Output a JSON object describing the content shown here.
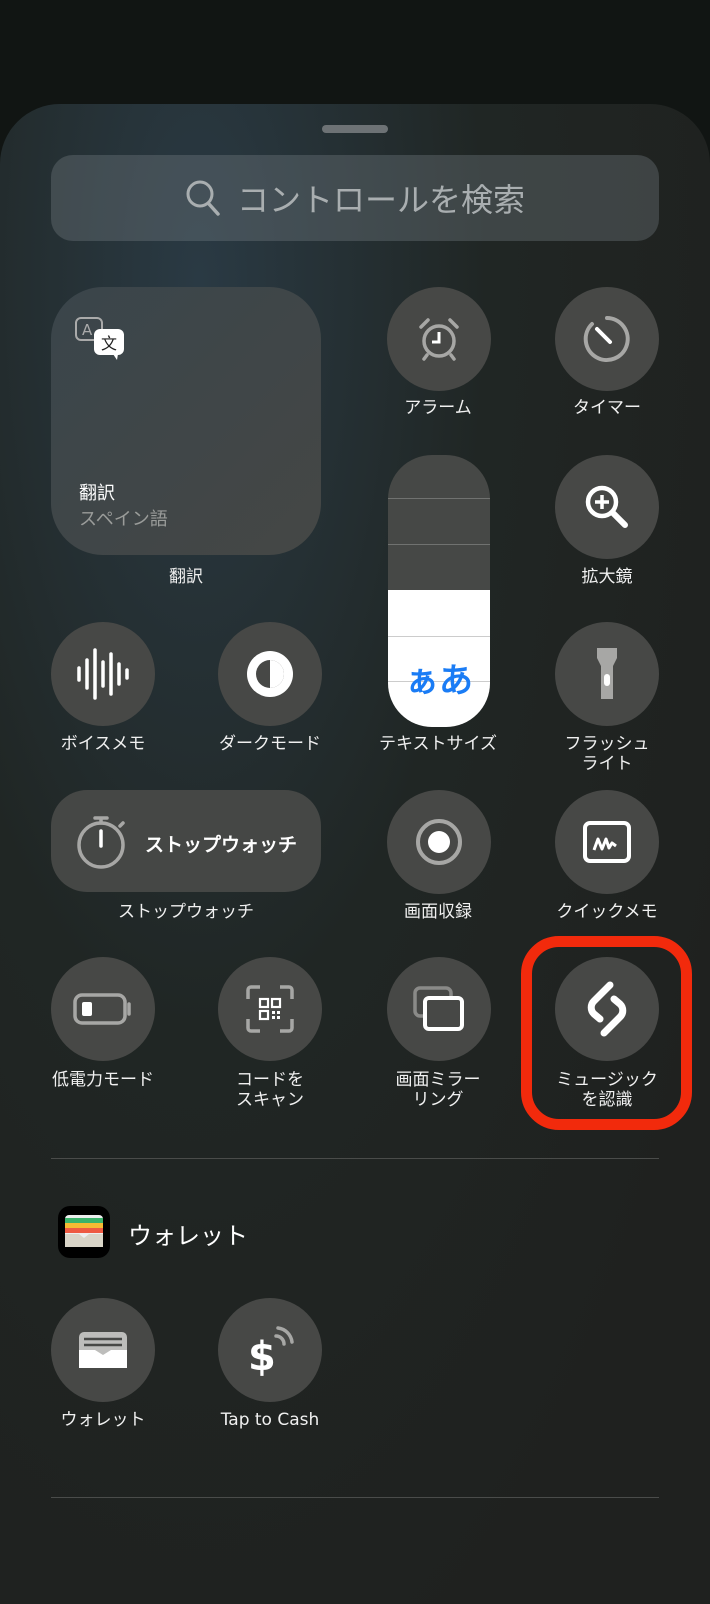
{
  "search": {
    "placeholder": "コントロールを検索"
  },
  "translate": {
    "title": "翻訳",
    "subtitle": "スペイン語",
    "label": "翻訳"
  },
  "controls": {
    "alarm": "アラーム",
    "timer": "タイマー",
    "magnifier": "拡大鏡",
    "text_size": "テキストサイズ",
    "text_size_glyph": "ぁあ",
    "text_size_level": 0.5,
    "voice_memo": "ボイスメモ",
    "dark_mode": "ダークモード",
    "flashlight_1": "フラッシュ",
    "flashlight_2": "ライト",
    "stopwatch_tile": "ストップウォッチ",
    "stopwatch": "ストップウォッチ",
    "screen_record": "画面収録",
    "quick_note": "クイックメモ",
    "low_power": "低電力モード",
    "scan_code_1": "コードを",
    "scan_code_2": "スキャン",
    "mirroring_1": "画面ミラー",
    "mirroring_2": "リング",
    "music_recog_1": "ミュージック",
    "music_recog_2": "を認識"
  },
  "wallet_section": {
    "title": "ウォレット",
    "items": [
      {
        "label": "ウォレット"
      },
      {
        "label": "Tap to Cash"
      }
    ]
  },
  "colors": {
    "highlight": "#f22a0c",
    "accent": "#1a7cf5"
  }
}
